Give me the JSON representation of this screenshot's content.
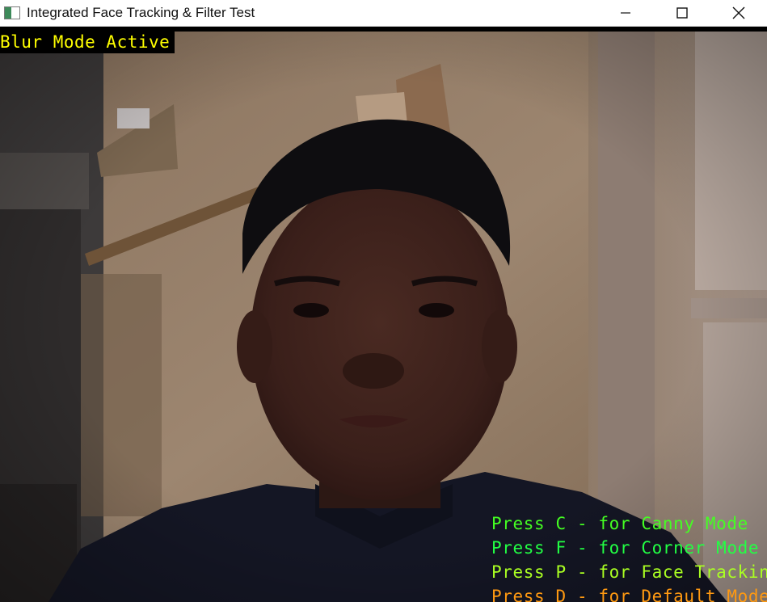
{
  "window": {
    "title": "Integrated Face Tracking & Filter Test",
    "controls": {
      "minimize": "minimize",
      "maximize": "maximize",
      "close": "close"
    }
  },
  "overlay": {
    "mode_label": "Blur Mode Active",
    "mode_label_color": "#ffff00",
    "hints": [
      {
        "text": "Press C - for Canny Mode",
        "color": "#44ff22"
      },
      {
        "text": "Press F - for Corner Mode",
        "color": "#22ff44"
      },
      {
        "text": "Press P - for Face Tracking",
        "color": "#aaff22"
      },
      {
        "text": "Press D - for Default Mode",
        "color": "#ff9911"
      }
    ]
  }
}
